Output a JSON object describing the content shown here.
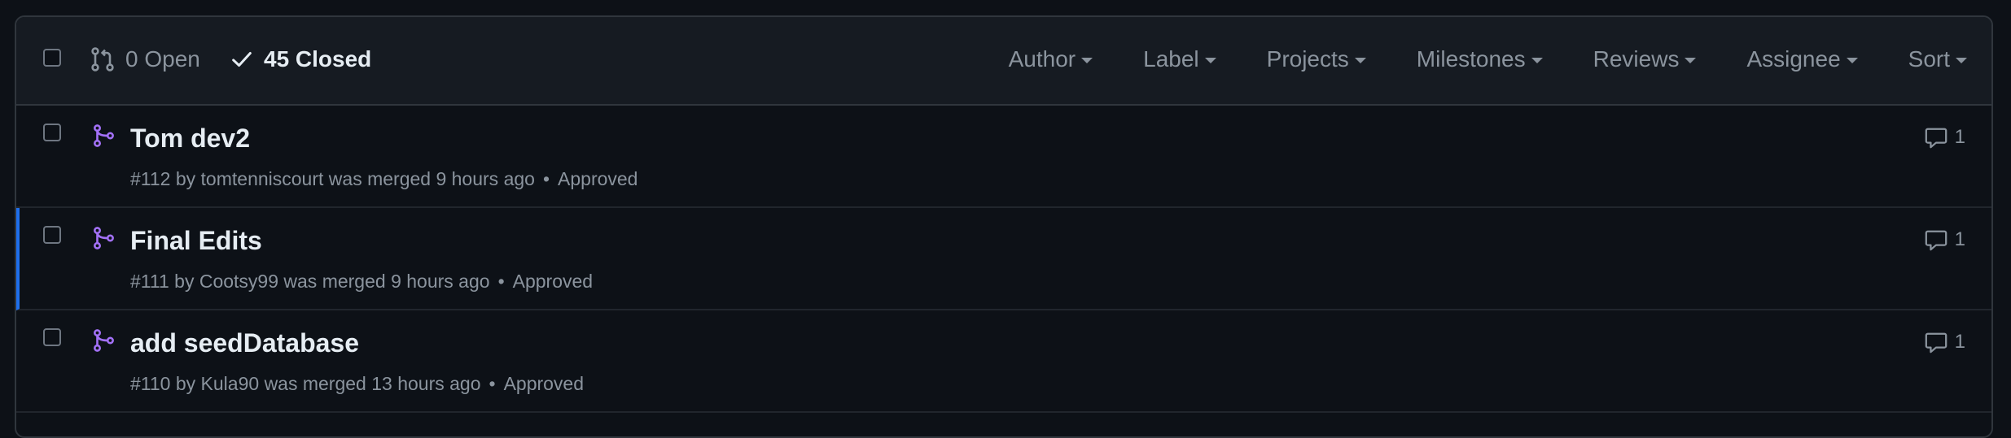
{
  "header": {
    "open_label": "0 Open",
    "closed_label": "45 Closed",
    "filters": [
      "Author",
      "Label",
      "Projects",
      "Milestones",
      "Reviews",
      "Assignee",
      "Sort"
    ]
  },
  "pull_requests": [
    {
      "title": "Tom dev2",
      "number": "#112",
      "by": "by",
      "author": "tomtenniscourt",
      "status_text": "was merged 9 hours ago",
      "review": "Approved",
      "comments": "1"
    },
    {
      "title": "Final Edits",
      "number": "#111",
      "by": "by",
      "author": "Cootsy99",
      "status_text": "was merged 9 hours ago",
      "review": "Approved",
      "comments": "1"
    },
    {
      "title": "add seedDatabase",
      "number": "#110",
      "by": "by",
      "author": "Kula90",
      "status_text": "was merged 13 hours ago",
      "review": "Approved",
      "comments": "1"
    }
  ],
  "colors": {
    "merged_icon": "#a371f7",
    "selected_accent": "#1f6feb",
    "background": "#0d1117",
    "header_background": "#161b22"
  },
  "icons": {
    "open": "git-pull-request-icon",
    "closed": "check-icon",
    "merged": "git-merge-icon",
    "comment": "comment-icon"
  }
}
